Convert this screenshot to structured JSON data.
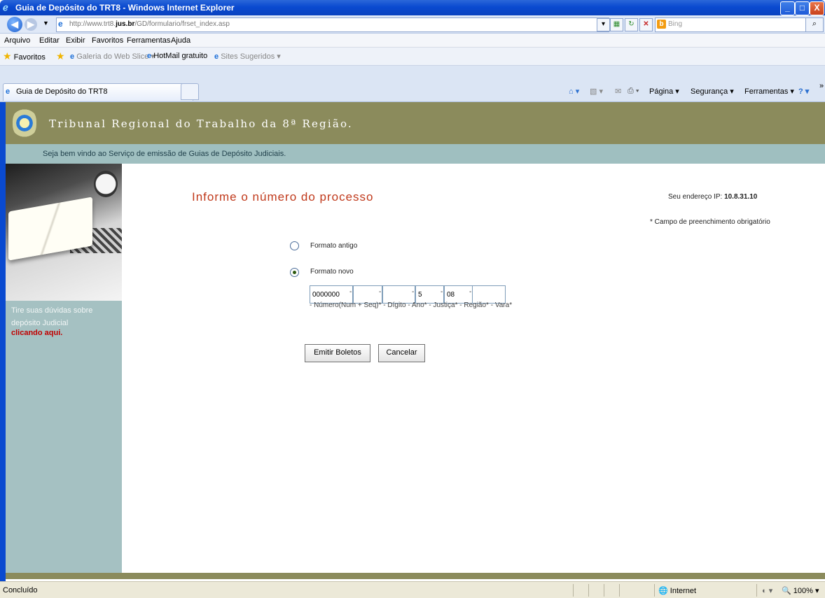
{
  "window": {
    "title": "Guia de Depósito do TRT8 - Windows Internet Explorer",
    "minimize": "_",
    "maximize": "□",
    "close": "X"
  },
  "address_bar": {
    "url_prefix": "http://www.trt8.",
    "url_domain": "jus.br",
    "url_suffix": "/GD/formulario/frset_index.asp",
    "search_placeholder": "Bing"
  },
  "menu": [
    "Arquivo",
    "Editar",
    "Exibir",
    "Favoritos",
    "Ferramentas",
    "Ajuda"
  ],
  "favorites_bar": {
    "favorites": "Favoritos",
    "web_slice": "Galeria do Web Slice ▾",
    "hotmail": "HotMail gratuito",
    "suggested": "Sites Sugeridos ▾"
  },
  "tabs": [
    {
      "label": "Guia de Depósito do TRT8"
    }
  ],
  "command_bar": {
    "page": "Página ▾",
    "security": "Segurança ▾",
    "tools": "Ferramentas ▾"
  },
  "page": {
    "site_title": "Tribunal Regional do Trabalho da 8ª Região.",
    "welcome": "Seja bem vindo ao Serviço de emissão de Guias de Depósito Judiciais.",
    "sidebar": {
      "help_text": "Tire suas dúvidas sobre depósito Judicial",
      "help_link": "clicando aqui."
    },
    "form": {
      "title": "Informe o número do processo",
      "ip_label": "Seu endereço IP:",
      "ip_value": "10.8.31.10",
      "required_note": "* Campo de preenchimento obrigatório",
      "option_old": "Formato antigo",
      "option_new": "Formato novo",
      "selected_option": "Formato novo",
      "fields": {
        "numero": "0000000",
        "digito": "",
        "ano": "",
        "justica": "5",
        "regiao": "08",
        "vara": ""
      },
      "field_help": "- Número(Num + Seq)* - Dígito - Ano* - Justiça* - Região* - Vara*",
      "submit_button": "Emitir Boletos",
      "cancel_button": "Cancelar"
    }
  },
  "status_bar": {
    "status": "Concluído",
    "zone": "Internet",
    "zoom": "100%"
  }
}
